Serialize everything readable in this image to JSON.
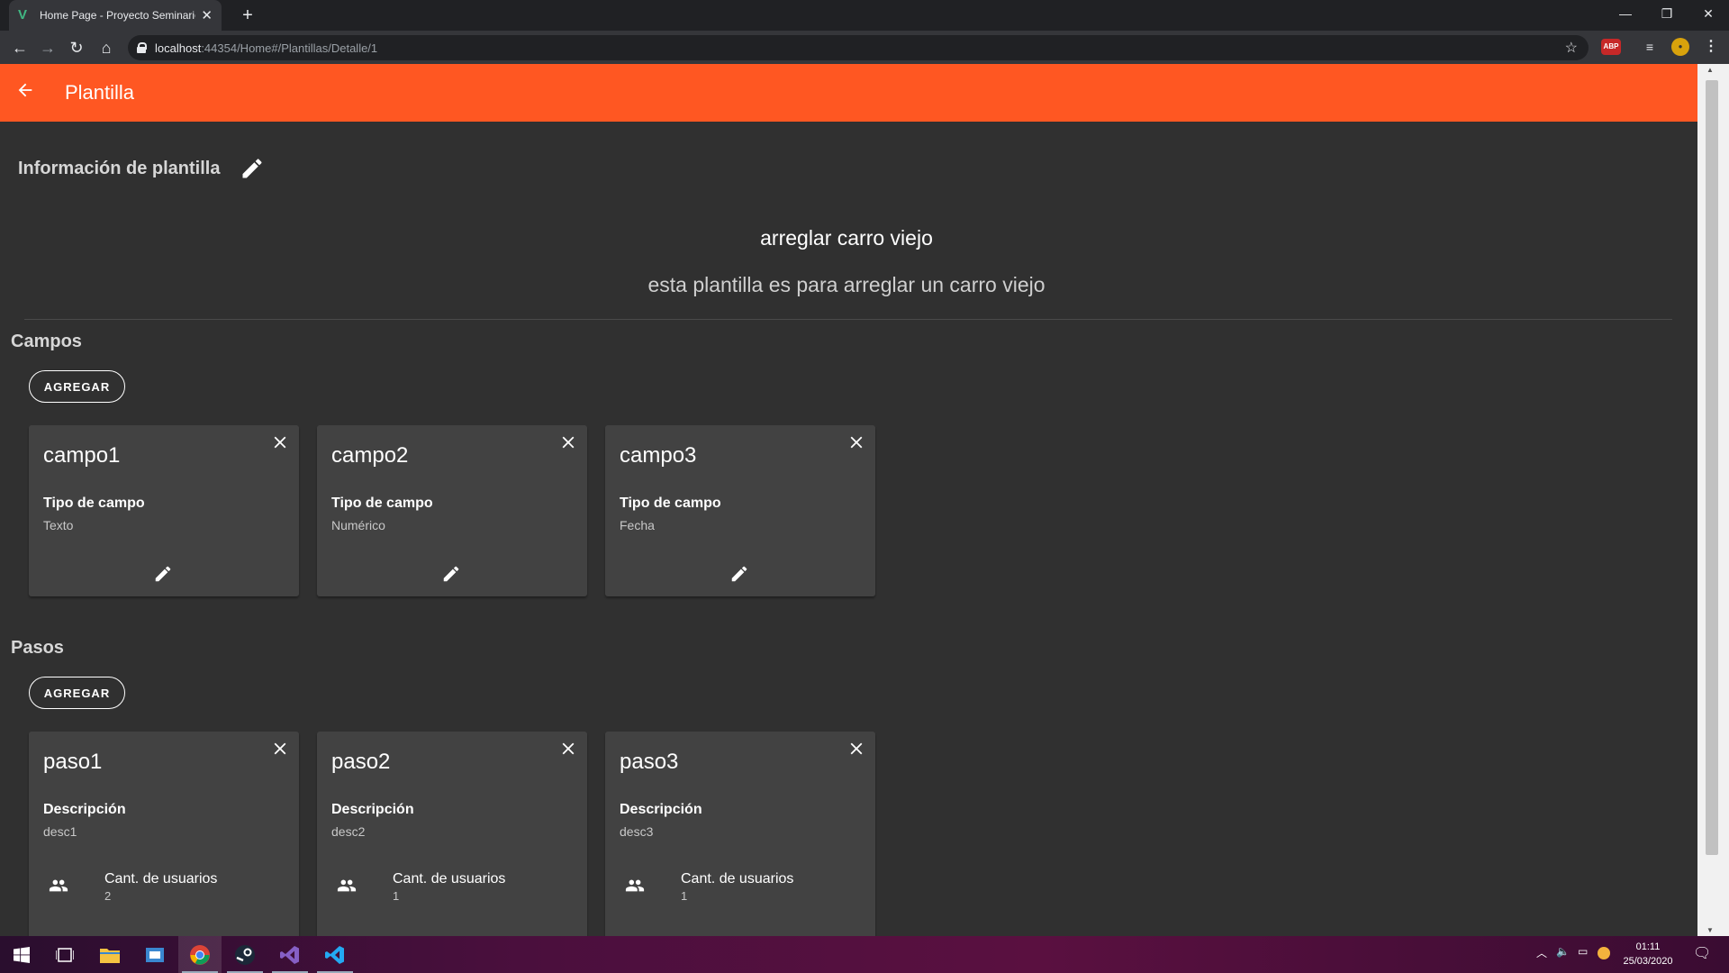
{
  "browser": {
    "tab_title": "Home Page - Proyecto Seminario",
    "url_host": "localhost",
    "url_path": ":44354/Home#/Plantillas/Detalle/1"
  },
  "appbar": {
    "title": "Plantilla"
  },
  "info": {
    "heading": "Información de plantilla",
    "name": "arreglar carro viejo",
    "description": "esta plantilla es para arreglar un carro viejo"
  },
  "campos": {
    "title": "Campos",
    "add_label": "AGREGAR",
    "type_label": "Tipo de campo",
    "items": [
      {
        "name": "campo1",
        "type": "Texto"
      },
      {
        "name": "campo2",
        "type": "Numérico"
      },
      {
        "name": "campo3",
        "type": "Fecha"
      }
    ]
  },
  "pasos": {
    "title": "Pasos",
    "add_label": "AGREGAR",
    "desc_label": "Descripción",
    "users_label": "Cant. de usuarios",
    "items": [
      {
        "name": "paso1",
        "desc": "desc1",
        "users": "2"
      },
      {
        "name": "paso2",
        "desc": "desc2",
        "users": "1"
      },
      {
        "name": "paso3",
        "desc": "desc3",
        "users": "1"
      }
    ]
  },
  "taskbar": {
    "time": "01:11",
    "date": "25/03/2020"
  },
  "colors": {
    "accent": "#ff5722",
    "background": "#303030",
    "card": "#424242"
  }
}
